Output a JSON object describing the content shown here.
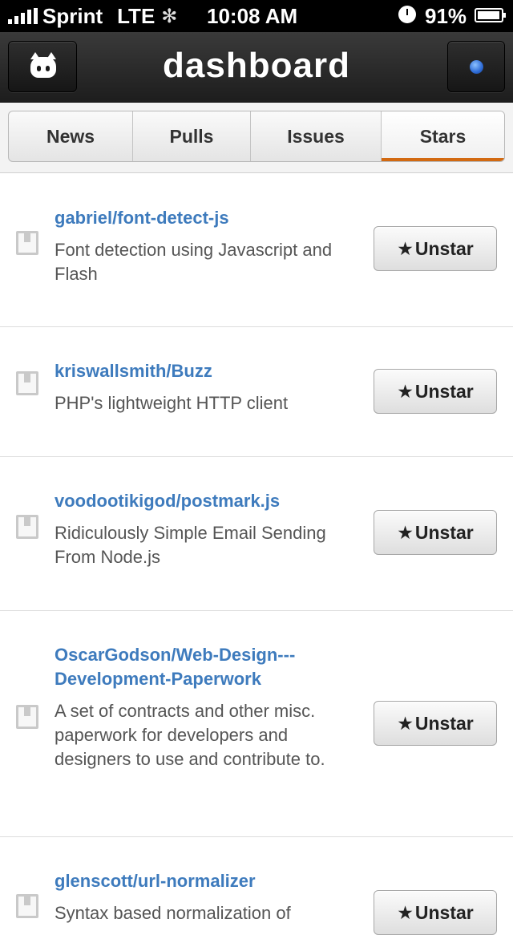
{
  "status_bar": {
    "carrier": "Sprint",
    "network": "LTE",
    "time": "10:08 AM",
    "battery": "91%"
  },
  "nav": {
    "title": "dashboard",
    "left_icon": "octocat-icon",
    "right_icon": "status-dot-icon"
  },
  "tabs": [
    {
      "label": "News",
      "active": false
    },
    {
      "label": "Pulls",
      "active": false
    },
    {
      "label": "Issues",
      "active": false
    },
    {
      "label": "Stars",
      "active": true
    }
  ],
  "accent_color": "#d26911",
  "link_color": "#3e7bbd",
  "repos": [
    {
      "name": "gabriel/font-detect-js",
      "description": "Font detection using Javascript and Flash",
      "button": "Unstar"
    },
    {
      "name": "kriswallsmith/Buzz",
      "description": "PHP's lightweight HTTP client",
      "button": "Unstar"
    },
    {
      "name": "voodootikigod/postmark.js",
      "description": "Ridiculously Simple Email Sending From Node.js",
      "button": "Unstar"
    },
    {
      "name": "OscarGodson/Web-Design---Development-Paperwork",
      "description": "A set of contracts and other misc. paperwork for developers and designers to use and contribute to.",
      "button": "Unstar"
    },
    {
      "name": "glenscott/url-normalizer",
      "description": "Syntax based normalization of",
      "button": "Unstar"
    }
  ],
  "star_glyph": "★"
}
